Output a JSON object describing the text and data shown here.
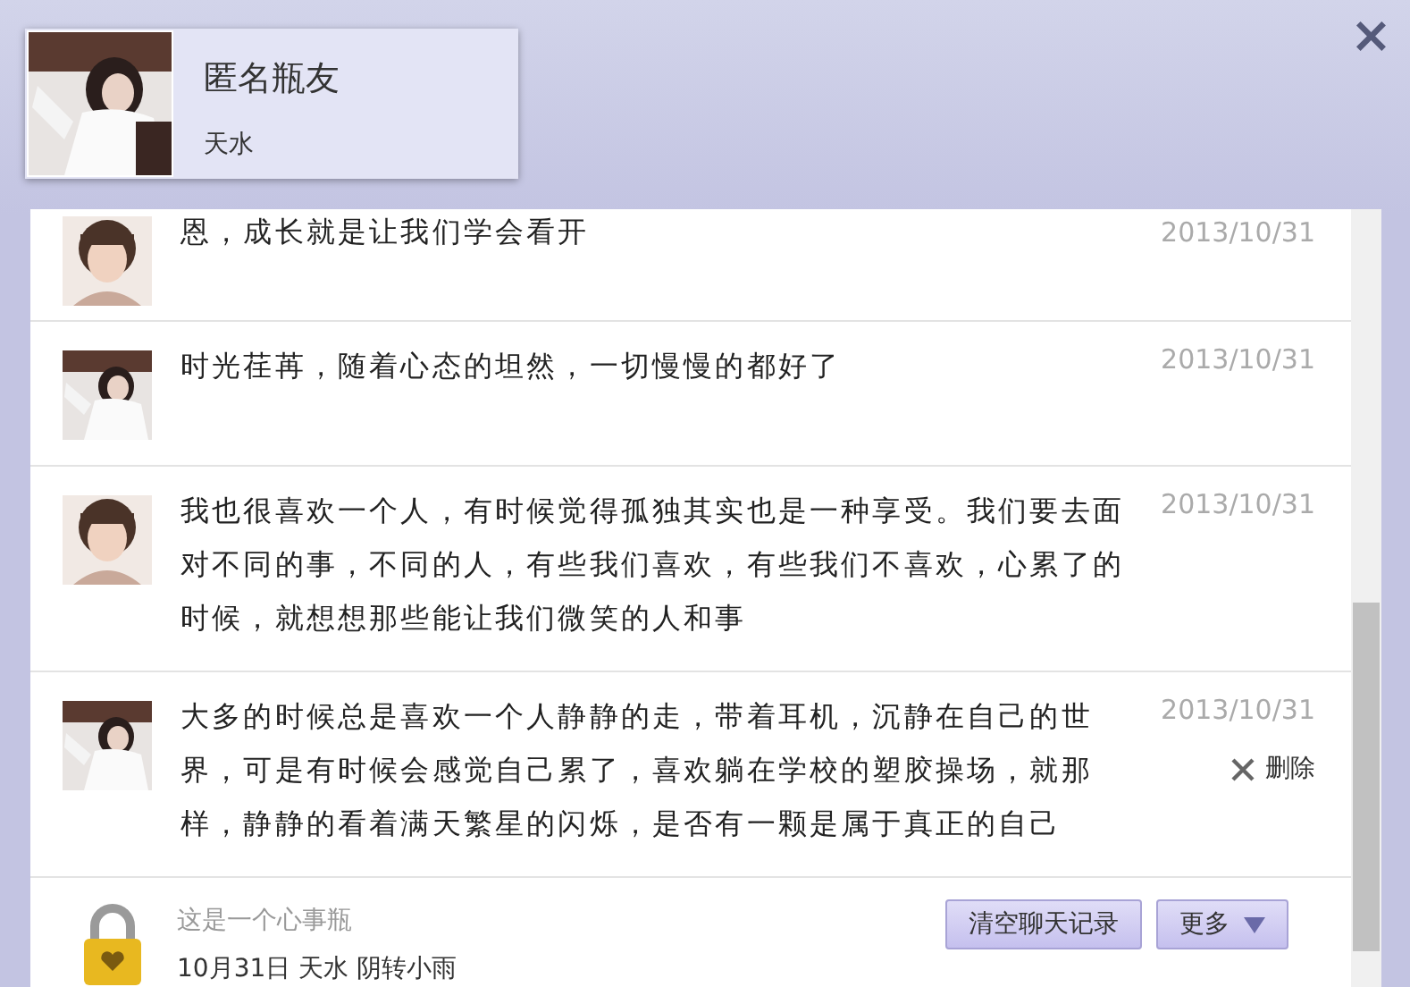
{
  "header": {
    "name": "匿名瓶友",
    "location": "天水"
  },
  "close": "×",
  "messages": [
    {
      "text": "恩，成长就是让我们学会看开",
      "date": "2013/10/31"
    },
    {
      "text": "时光荏苒，随着心态的坦然，一切慢慢的都好了",
      "date": "2013/10/31"
    },
    {
      "text": "我也很喜欢一个人，有时候觉得孤独其实也是一种享受。我们要去面对不同的事，不同的人，有些我们喜欢，有些我们不喜欢，心累了的时候，就想想那些能让我们微笑的人和事",
      "date": "2013/10/31"
    },
    {
      "text": "大多的时候总是喜欢一个人静静的走，带着耳机，沉静在自己的世界，可是有时候会感觉自己累了，喜欢躺在学校的塑胶操场，就那样，静静的看着满天繁星的闪烁，是否有一颗是属于真正的自己",
      "date": "2013/10/31",
      "delete_label": "删除"
    }
  ],
  "footer": {
    "caption": "这是一个心事瓶",
    "info": "10月31日 天水 阴转小雨",
    "buttons": [
      {
        "label": "清空聊天记录",
        "kind": "plain"
      },
      {
        "label": "更多",
        "kind": "dropdown"
      }
    ]
  }
}
